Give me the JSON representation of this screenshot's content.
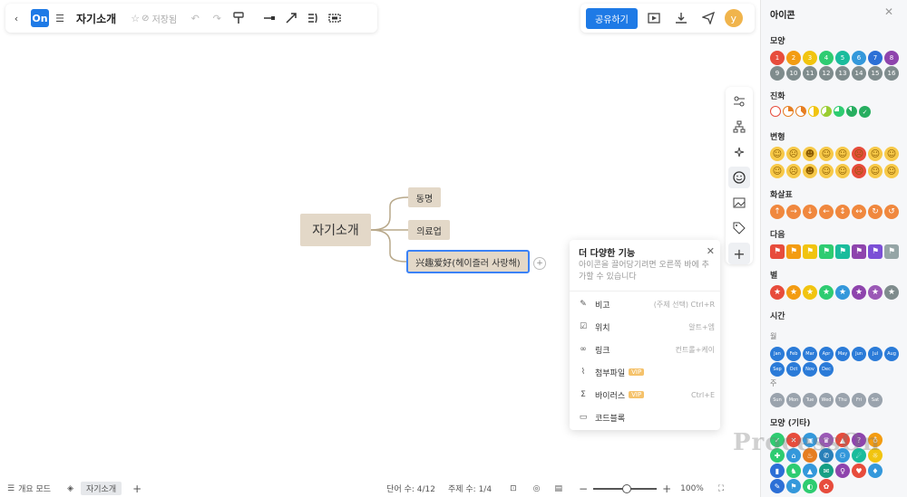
{
  "app": {
    "logo_text": "On",
    "doc_title": "자기소개",
    "saved_label": "저장됨",
    "share_label": "공유하기",
    "avatar_letter": "y"
  },
  "map": {
    "root": "자기소개",
    "children": [
      "동명",
      "의료업",
      "兴趣爱好(헤이즐러 사랑해)"
    ]
  },
  "popover": {
    "title": "더 다양한 기능",
    "desc": "아이콘을 끌어당기려면 오른쪽 바에 추가할 수 있습니다",
    "items": [
      {
        "label": "비고",
        "shortcut": "(주제 선택) Ctrl+R",
        "icon": "note-icon"
      },
      {
        "label": "위치",
        "shortcut": "알트+엠",
        "icon": "check-square-icon"
      },
      {
        "label": "링크",
        "shortcut": "컨트롤+케이",
        "icon": "link-icon"
      },
      {
        "label": "첨부파일",
        "shortcut": "",
        "vip": "VIP",
        "icon": "attachment-icon"
      },
      {
        "label": "바이러스",
        "shortcut": "Ctrl+E",
        "vip": "VIP",
        "icon": "formula-icon"
      },
      {
        "label": "코드블록",
        "shortcut": "",
        "icon": "code-icon"
      }
    ]
  },
  "panel": {
    "title": "아이콘",
    "sections": {
      "shape": "모양",
      "progress": "진화",
      "face": "변형",
      "arrow": "화살표",
      "flag": "다음",
      "star": "별",
      "time": "시간",
      "month": "월",
      "week": "주",
      "other": "모양 (기타)"
    },
    "numbers": [
      "1",
      "2",
      "3",
      "4",
      "5",
      "6",
      "7",
      "8",
      "9",
      "10",
      "11",
      "12",
      "13",
      "14",
      "15",
      "16"
    ],
    "number_colors": [
      "#e74c3c",
      "#f39c12",
      "#f1c40f",
      "#2ecc71",
      "#1abc9c",
      "#3498db",
      "#2c6fd6",
      "#8e44ad",
      "#7f8c8d",
      "#7f8c8d",
      "#7f8c8d",
      "#7f8c8d",
      "#7f8c8d",
      "#7f8c8d",
      "#7f8c8d",
      "#7f8c8d"
    ],
    "months": [
      "Jan",
      "Feb",
      "Mar",
      "Apr",
      "May",
      "Jun",
      "Jul",
      "Aug",
      "Sep",
      "Oct",
      "Nov",
      "Dec"
    ],
    "weekdays": [
      "Sun",
      "Mon",
      "Tue",
      "Wed",
      "Thu",
      "Fri",
      "Sat"
    ],
    "watermark": "ProcessOn"
  },
  "bottom": {
    "outline_label": "개요 모드",
    "tab_label": "자기소개",
    "word_count": "단어 수:  4/12",
    "topic_count": "주제 수:  1/4",
    "zoom": "100%",
    "zoom_level": 0.45
  }
}
